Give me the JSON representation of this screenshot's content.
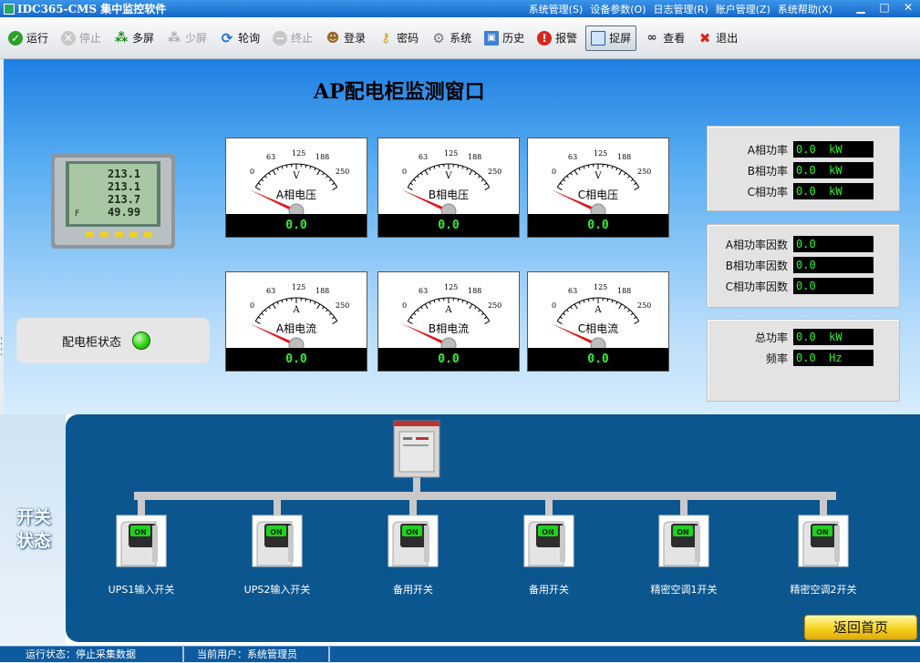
{
  "titlebar": {
    "app_title": "IDC365-CMS 集中监控软件",
    "menu": [
      "系统管理(S)",
      "设备参数(O)",
      "日志管理(R)",
      "账户管理(Z)",
      "系统帮助(X)"
    ],
    "controls": [
      "▁",
      "□",
      "✕"
    ]
  },
  "toolbar": {
    "items": [
      {
        "label": "运行",
        "icon": "check-icon",
        "enabled": true
      },
      {
        "label": "停止",
        "icon": "stop-icon",
        "enabled": false
      },
      {
        "label": "多屏",
        "icon": "multi-screen-icon",
        "enabled": true
      },
      {
        "label": "少屏",
        "icon": "few-screen-icon",
        "enabled": false
      },
      {
        "label": "轮询",
        "icon": "refresh-icon",
        "enabled": true
      },
      {
        "label": "终止",
        "icon": "terminate-icon",
        "enabled": false
      },
      {
        "label": "登录",
        "icon": "user-icon",
        "enabled": true
      },
      {
        "label": "密码",
        "icon": "key-icon",
        "enabled": true
      },
      {
        "label": "系统",
        "icon": "gear-icon",
        "enabled": true
      },
      {
        "label": "历史",
        "icon": "history-icon",
        "enabled": true
      },
      {
        "label": "报警",
        "icon": "alarm-icon",
        "enabled": true
      },
      {
        "label": "捉屏",
        "icon": "capture-icon",
        "enabled": true,
        "active": true
      },
      {
        "label": "查看",
        "icon": "binoculars-icon",
        "enabled": true
      },
      {
        "label": "退出",
        "icon": "exit-icon",
        "enabled": true
      }
    ]
  },
  "monitor": {
    "title": "AP配电柜监测窗口",
    "cabinet_status_label": "配电柜状态",
    "cabinet_status_color": "#2fd11a",
    "gauge_ticks": [
      "0",
      "63",
      "125",
      "188",
      "250"
    ],
    "gauges": [
      {
        "name": "A相电压",
        "unit": "V",
        "value": "0.0"
      },
      {
        "name": "B相电压",
        "unit": "V",
        "value": "0.0"
      },
      {
        "name": "C相电压",
        "unit": "V",
        "value": "0.0"
      },
      {
        "name": "A相电流",
        "unit": "A",
        "value": "0.0"
      },
      {
        "name": "B相电流",
        "unit": "A",
        "value": "0.0"
      },
      {
        "name": "C相电流",
        "unit": "A",
        "value": "0.0"
      }
    ],
    "power_panel": [
      {
        "label": "A相功率",
        "value": "0.0  kW"
      },
      {
        "label": "B相功率",
        "value": "0.0  kW"
      },
      {
        "label": "C相功率",
        "value": "0.0  kW"
      }
    ],
    "pf_panel": [
      {
        "label": "A相功率因数",
        "value": "0.0"
      },
      {
        "label": "B相功率因数",
        "value": "0.0"
      },
      {
        "label": "C相功率因数",
        "value": "0.0"
      }
    ],
    "total_panel": [
      {
        "label": "总功率",
        "value": "0.0  kW"
      },
      {
        "label": "频率",
        "value": "0.0  Hz"
      }
    ],
    "meter_display": [
      "213.1",
      "213.1",
      "213.7",
      "49.99"
    ]
  },
  "switches": {
    "section_label": "开关状态",
    "items": [
      {
        "label": "UPS1输入开关",
        "state": "ON"
      },
      {
        "label": "UPS2输入开关",
        "state": "ON"
      },
      {
        "label": "备用开关",
        "state": "ON"
      },
      {
        "label": "备用开关",
        "state": "ON"
      },
      {
        "label": "精密空调1开关",
        "state": "ON"
      },
      {
        "label": "精密空调2开关",
        "state": "ON"
      }
    ],
    "home_button": "返回首页"
  },
  "statusbar": {
    "run_state": "运行状态：停止采集数据",
    "current_user": "当前用户：系统管理员"
  },
  "colors": {
    "readout_green": "#2cf52c",
    "switch_panel_bg": "#0b568f",
    "switch_on_green": "#1fd21f"
  }
}
